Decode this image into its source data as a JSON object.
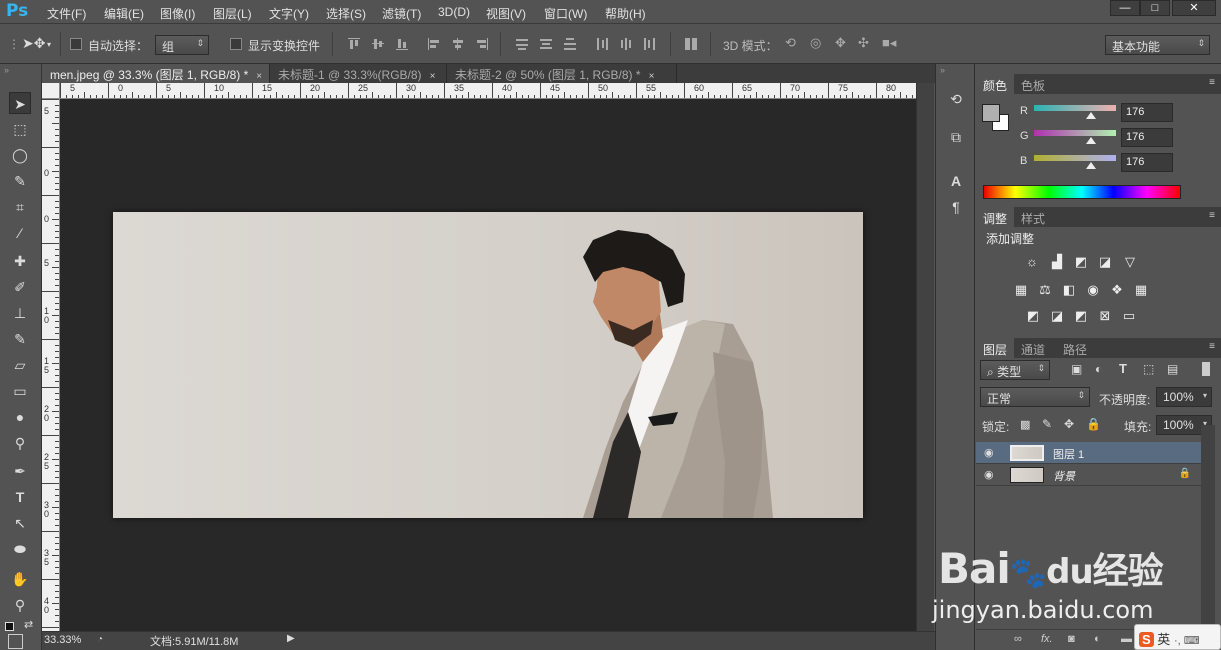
{
  "app": {
    "logo": "Ps"
  },
  "menu": [
    "文件(F)",
    "编辑(E)",
    "图像(I)",
    "图层(L)",
    "文字(Y)",
    "选择(S)",
    "滤镜(T)",
    "3D(D)",
    "视图(V)",
    "窗口(W)",
    "帮助(H)"
  ],
  "window_controls": {
    "minimize": "—",
    "maximize": "□",
    "close": "✕"
  },
  "options": {
    "auto_select_label": "自动选择：",
    "auto_select_value": "组",
    "show_transform_label": "显示变换控件",
    "mode_3d_label": "3D 模式：",
    "workspace": "基本功能"
  },
  "tabs": [
    {
      "label": "men.jpeg @ 33.3% (图层 1, RGB/8) *",
      "active": true
    },
    {
      "label": "未标题-1 @ 33.3%(RGB/8)",
      "active": false
    },
    {
      "label": "未标题-2 @ 50% (图层 1, RGB/8) *",
      "active": false
    }
  ],
  "tab_close": "×",
  "ruler_h": [
    "5",
    "0",
    "5",
    "10",
    "15",
    "20",
    "25",
    "30",
    "35",
    "40",
    "45",
    "50",
    "55",
    "60",
    "65",
    "70",
    "75",
    "80"
  ],
  "ruler_v": [
    "5",
    "0",
    "5",
    "0",
    "5",
    "10",
    "15",
    "20",
    "25",
    "30",
    "35",
    "40",
    "45",
    "50",
    "55",
    "60"
  ],
  "status": {
    "zoom": "33.33%",
    "doc": "文档:5.91M/11.8M",
    "arrow": "▶"
  },
  "color_panel": {
    "tabs": [
      "颜色",
      "色板"
    ],
    "channels": [
      {
        "label": "R",
        "value": "176",
        "gradient": [
          "#2bb3b3",
          "#f0b0b0"
        ]
      },
      {
        "label": "G",
        "value": "176",
        "gradient": [
          "#b030b0",
          "#b0f0b0"
        ]
      },
      {
        "label": "B",
        "value": "176",
        "gradient": [
          "#b0b030",
          "#b0b0f0"
        ]
      }
    ],
    "foreground": "#b0b0b0",
    "background": "#ffffff"
  },
  "adjust_panel": {
    "tabs": [
      "调整",
      "样式"
    ],
    "title": "添加调整"
  },
  "layers_panel": {
    "tabs": [
      "图层",
      "通道",
      "路径"
    ],
    "filter_kind": "类型",
    "blend_mode": "正常",
    "opacity_label": "不透明度:",
    "opacity": "100%",
    "lock_label": "锁定:",
    "fill_label": "填充:",
    "fill": "100%",
    "layers": [
      {
        "name": "图层 1",
        "selected": true,
        "locked": false
      },
      {
        "name": "背景",
        "selected": false,
        "locked": true
      }
    ],
    "footer_icons": [
      "link-icon",
      "fx-icon",
      "mask-icon",
      "adjustment-icon",
      "folder-icon",
      "new-layer-icon",
      "trash-icon"
    ],
    "footer_fx": "fx."
  },
  "watermark": {
    "logo_a": "Bai",
    "logo_b": "du",
    "logo_c": "经验",
    "url": "jingyan.baidu.com"
  },
  "ime": {
    "s": "S",
    "lang": "英",
    "rest": "·, ⌨"
  }
}
